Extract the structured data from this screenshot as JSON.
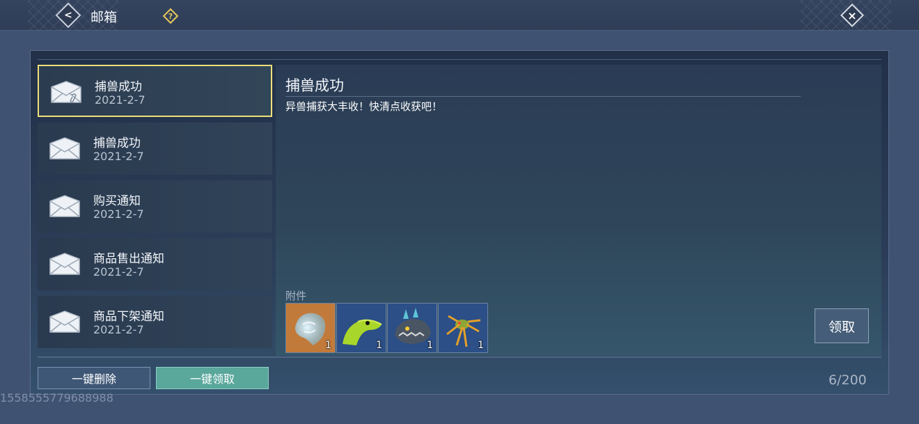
{
  "header": {
    "title": "邮箱",
    "back_icon": "back-arrow-icon",
    "help_icon": "question-icon",
    "close_icon": "close-x-icon"
  },
  "mail_list": [
    {
      "subject": "捕兽成功",
      "date": "2021-2-7",
      "selected": true,
      "icon": "envelope-attachment-icon"
    },
    {
      "subject": "捕兽成功",
      "date": "2021-2-7",
      "selected": false,
      "icon": "envelope-icon"
    },
    {
      "subject": "购买通知",
      "date": "2021-2-7",
      "selected": false,
      "icon": "envelope-icon"
    },
    {
      "subject": "商品售出通知",
      "date": "2021-2-7",
      "selected": false,
      "icon": "envelope-icon"
    },
    {
      "subject": "商品下架通知",
      "date": "2021-2-7",
      "selected": false,
      "icon": "envelope-icon"
    }
  ],
  "detail": {
    "title": "捕兽成功",
    "body": "异兽捕获大丰收！快清点收获吧！",
    "attachments_label": "附件",
    "attachments": [
      {
        "icon": "blue-wisp-beast-icon",
        "qty": "1",
        "bg": "#c27a3a"
      },
      {
        "icon": "green-lizard-icon",
        "qty": "1",
        "bg": "#2b4f86"
      },
      {
        "icon": "armored-beast-icon",
        "qty": "1",
        "bg": "#2b4f86"
      },
      {
        "icon": "spider-beast-icon",
        "qty": "1",
        "bg": "#2b4f86"
      }
    ],
    "claim_label": "领取"
  },
  "footer": {
    "delete_all_label": "一键删除",
    "claim_all_label": "一键领取",
    "count": "6/200"
  },
  "watermark": "1558555779688988",
  "colors": {
    "selected_border": "#efe07a",
    "claim_all_bg": "#5aa79c",
    "help_accent": "#e9c95a"
  }
}
